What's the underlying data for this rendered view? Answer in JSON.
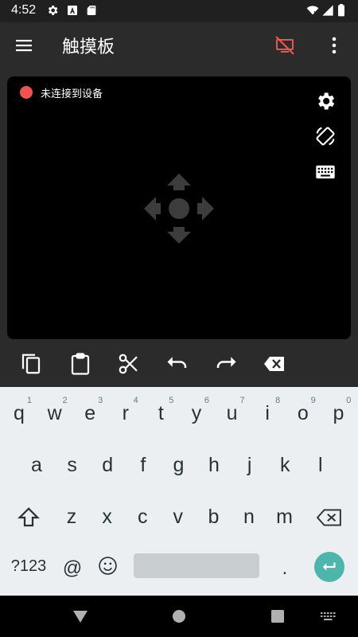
{
  "status_bar": {
    "time": "4:52",
    "icons": [
      "gear-icon",
      "a-box-icon",
      "sd-card-icon",
      "wifi-icon",
      "signal-icon",
      "battery-icon"
    ]
  },
  "app_bar": {
    "title": "触摸板",
    "menu_icon": "hamburger-menu-icon",
    "status_icon": "screen-disconnected-icon",
    "status_icon_color": "#ef5350",
    "more_icon": "more-vertical-icon"
  },
  "touchpad": {
    "connection_status": "未连接到设备",
    "status_color": "#ef5350",
    "side_icons": [
      "settings-icon",
      "screen-rotation-icon",
      "keyboard-icon"
    ],
    "center_icon": "dpad-move-icon"
  },
  "edit_toolbar": {
    "icons": [
      "copy-icon",
      "paste-icon",
      "cut-icon",
      "undo-icon",
      "redo-icon",
      "backspace-icon"
    ]
  },
  "keyboard": {
    "row1": [
      {
        "c": "q",
        "h": "1"
      },
      {
        "c": "w",
        "h": "2"
      },
      {
        "c": "e",
        "h": "3"
      },
      {
        "c": "r",
        "h": "4"
      },
      {
        "c": "t",
        "h": "5"
      },
      {
        "c": "y",
        "h": "6"
      },
      {
        "c": "u",
        "h": "7"
      },
      {
        "c": "i",
        "h": "8"
      },
      {
        "c": "o",
        "h": "9"
      },
      {
        "c": "p",
        "h": "0"
      }
    ],
    "row2": [
      "a",
      "s",
      "d",
      "f",
      "g",
      "h",
      "j",
      "k",
      "l"
    ],
    "row3": [
      "z",
      "x",
      "c",
      "v",
      "b",
      "n",
      "m"
    ],
    "symbols_label": "?123",
    "at_label": "@",
    "period_label": ".",
    "accent_color": "#4db6ac"
  },
  "nav_bar": {
    "icons": [
      "back-icon",
      "home-icon",
      "recents-icon",
      "keyboard-switch-icon"
    ]
  }
}
